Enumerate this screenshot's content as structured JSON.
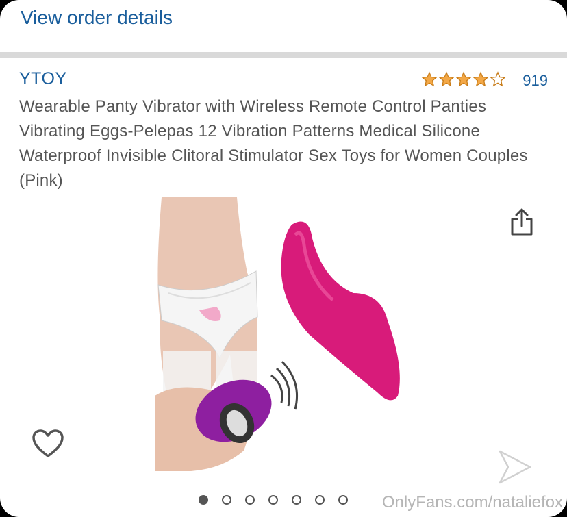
{
  "order": {
    "link_label": "View order details"
  },
  "product": {
    "brand": "YTOY",
    "rating_stars": 4,
    "rating_count": "919",
    "title": "Wearable Panty Vibrator with Wireless Remote Control Panties Vibrating Eggs-Pelepas 12 Vibration Patterns Medical Silicone Waterproof Invisible Clitoral Stimulator Sex Toys for Women Couples (Pink)"
  },
  "carousel": {
    "total": 7,
    "active_index": 0
  },
  "icons": {
    "share": "share-icon",
    "favorite": "heart-icon",
    "next": "chevron-right-icon"
  },
  "colors": {
    "link": "#1a5e9c",
    "star": "#f3a847",
    "product_pink": "#d81b7a",
    "remote_purple": "#8e1fa0"
  },
  "watermark": "OnlyFans.com/nataliefox"
}
